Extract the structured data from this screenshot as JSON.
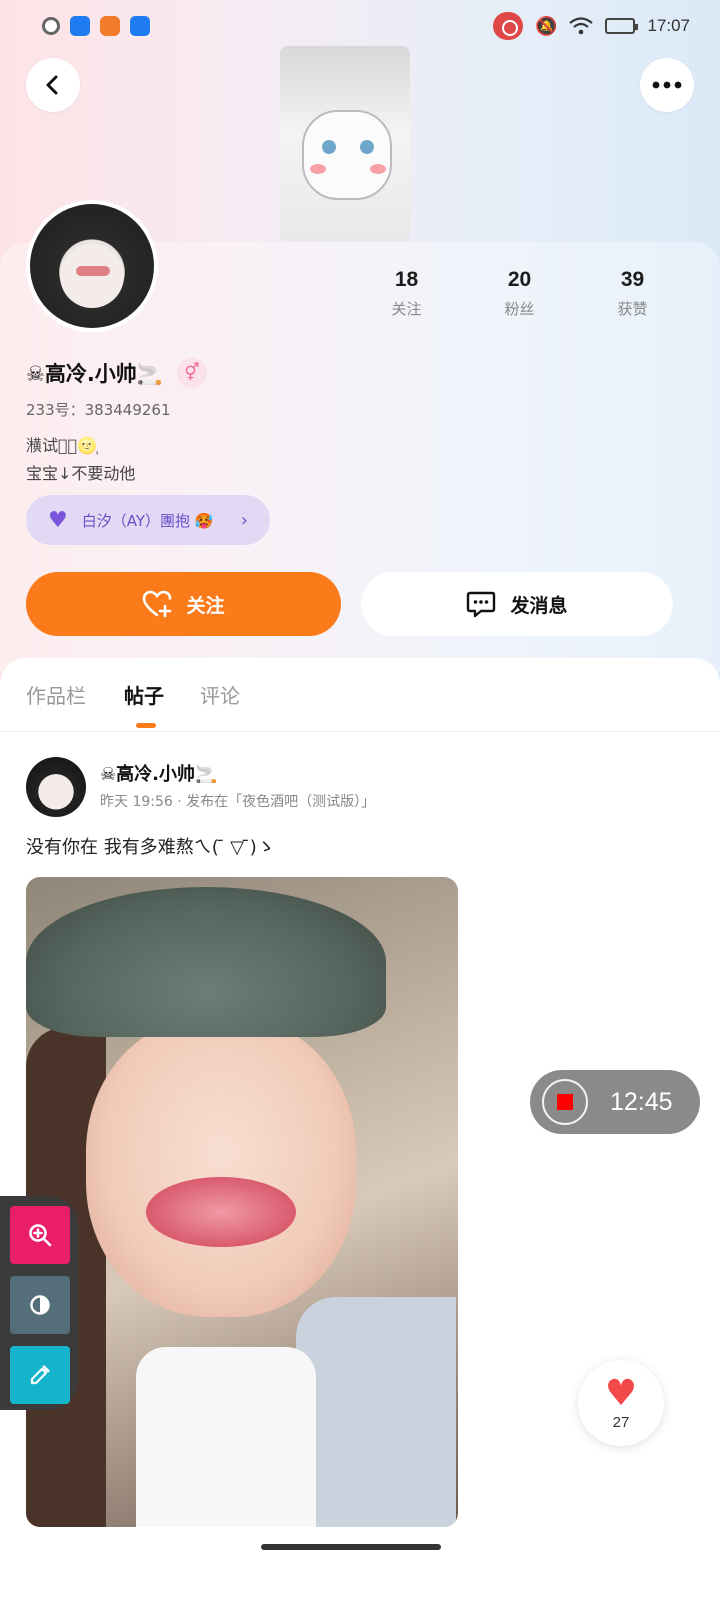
{
  "status_bar": {
    "time": "17:07"
  },
  "profile": {
    "username": "☠高冷.小帅🚬",
    "gender_icon": "⚥",
    "uid": "233号：383449261",
    "bio_line1": "㶇试穿᷂🌝᷂",
    "bio_line2": "宝宝↓不要动他",
    "stats": [
      {
        "num": "18",
        "label": "关注"
      },
      {
        "num": "20",
        "label": "粉丝"
      },
      {
        "num": "39",
        "label": "获赞"
      }
    ],
    "group_chip": "白汐（AY）團抱 🥵",
    "follow_label": "关注",
    "message_label": "发消息"
  },
  "tabs": [
    "作品栏",
    "帖子",
    "评论"
  ],
  "post": {
    "username": "☠高冷.小帅🚬",
    "meta": "昨天 19:56 · 发布在「夜色酒吧（测试版）」",
    "text": "没有你在 我有多难熬ㄟ( ̄ ▽  ̄)ゝ"
  },
  "recording": {
    "time": "12:45"
  },
  "like": {
    "count": "27"
  },
  "colors": {
    "accent": "#fb7a1a",
    "chip_bg": "#e2daf5",
    "chip_text": "#6b4fc8"
  }
}
